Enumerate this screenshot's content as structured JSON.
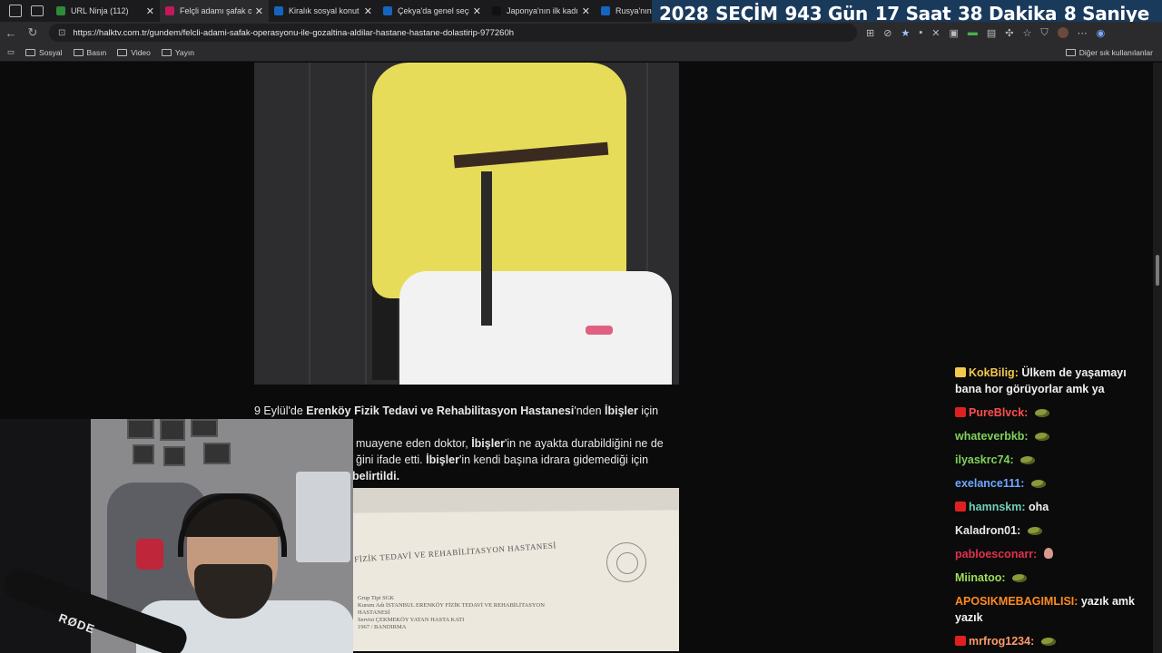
{
  "tabs": [
    {
      "title": "URL Ninja (112)",
      "favicon_color": "#2e8b3a",
      "active": false
    },
    {
      "title": "Felçli adamı şafak ope",
      "favicon_color": "#c2185b",
      "active": true
    },
    {
      "title": "Kiralık sosyal konut pr",
      "favicon_color": "#1565c0",
      "active": false
    },
    {
      "title": "Çekya'da genel seçim",
      "favicon_color": "#1565c0",
      "active": false
    },
    {
      "title": "Japonya'nın ilk kadın",
      "favicon_color": "#111111",
      "active": false
    },
    {
      "title": "Rusya'nın U",
      "favicon_color": "#1565c0",
      "active": false
    }
  ],
  "countdown": {
    "year": "2028",
    "label": "SEÇİM",
    "days": "943 Gün",
    "hours": "17 Saat",
    "minutes": "38 Dakika",
    "seconds": "8 Saniye"
  },
  "address": {
    "url": "https://halktv.com.tr/gundem/felcli-adami-safak-operasyonu-ile-gozaltina-aldilar-hastane-hastane-dolastirip-977260h"
  },
  "bookmarks": {
    "items": [
      "Sosyal",
      "Basın",
      "Video",
      "Yayın"
    ],
    "other": "Diğer sık kullanılanlar"
  },
  "article": {
    "p1_a": "9 Eylül'de ",
    "p1_b": "Erenköy Fizik Tedavi ve Rehabilitasyon Hastanesi",
    "p1_c": "'nden ",
    "p1_d": "İbişler",
    "p1_e": " için rapor",
    "p1_line2_a": "muayene eden doktor, ",
    "p1_line2_b": "İbişler",
    "p1_line2_c": "'in ne ayakta durabildiğini ne de",
    "p1_line3_a": "ğini ifade etti. ",
    "p1_line3_b": "İbişler",
    "p1_line3_c": "'in kendi başına idrara gidemediği için",
    "p1_line4": "belirtildi."
  },
  "document": {
    "header": "FİZİK TEDAVİ VE REHABİLİTASYON HASTANESİ",
    "lines": [
      "Grup Tipi    SGK",
      "Kurum Adı   İSTANBUL ERENKÖY FİZİK TEDAVİ VE REHABİLİTASYON",
      "                    HASTANESİ",
      "Servisi       ÇEKMEKÖY YATAN HASTA KATI",
      "1967 / BANDIRMA"
    ]
  },
  "webcam": {
    "mic_brand": "RØDE"
  },
  "chat": [
    {
      "user": "KokBilig",
      "color": "#f2c94c",
      "badge": "#f2c94c",
      "text": "Ülkem de yaşamayı bana hor görüyorlar amk ya",
      "emote": ""
    },
    {
      "user": "PureBlvck",
      "color": "#ff4d4d",
      "badge": "#e02020",
      "text": "",
      "emote": "frog"
    },
    {
      "user": "whateverbkb",
      "color": "#7fd35a",
      "badge": "",
      "text": "",
      "emote": "frog"
    },
    {
      "user": "ilyaskrc74",
      "color": "#7fd35a",
      "badge": "",
      "text": "",
      "emote": "frog"
    },
    {
      "user": "exelance111",
      "color": "#6fa8ff",
      "badge": "",
      "text": "",
      "emote": "frog"
    },
    {
      "user": "hamnskm",
      "color": "#6fd0b8",
      "badge": "#e02020",
      "text": "oha",
      "emote": ""
    },
    {
      "user": "Kaladron01",
      "color": "#e8e8e8",
      "badge": "",
      "text": "",
      "emote": "frog"
    },
    {
      "user": "pabloesconarr",
      "color": "#e03050",
      "badge": "",
      "text": "",
      "emote": "head"
    },
    {
      "user": "Miinatoo",
      "color": "#9ee05a",
      "badge": "",
      "text": "",
      "emote": "frog"
    },
    {
      "user": "APOSIKMEBAGIMLISI",
      "color": "#ff8a1f",
      "badge": "",
      "text": "yazık amk yazık",
      "emote": ""
    },
    {
      "user": "mrfrog1234",
      "color": "#ff9a6a",
      "badge": "#e02020",
      "text": "",
      "emote": "frog"
    }
  ]
}
